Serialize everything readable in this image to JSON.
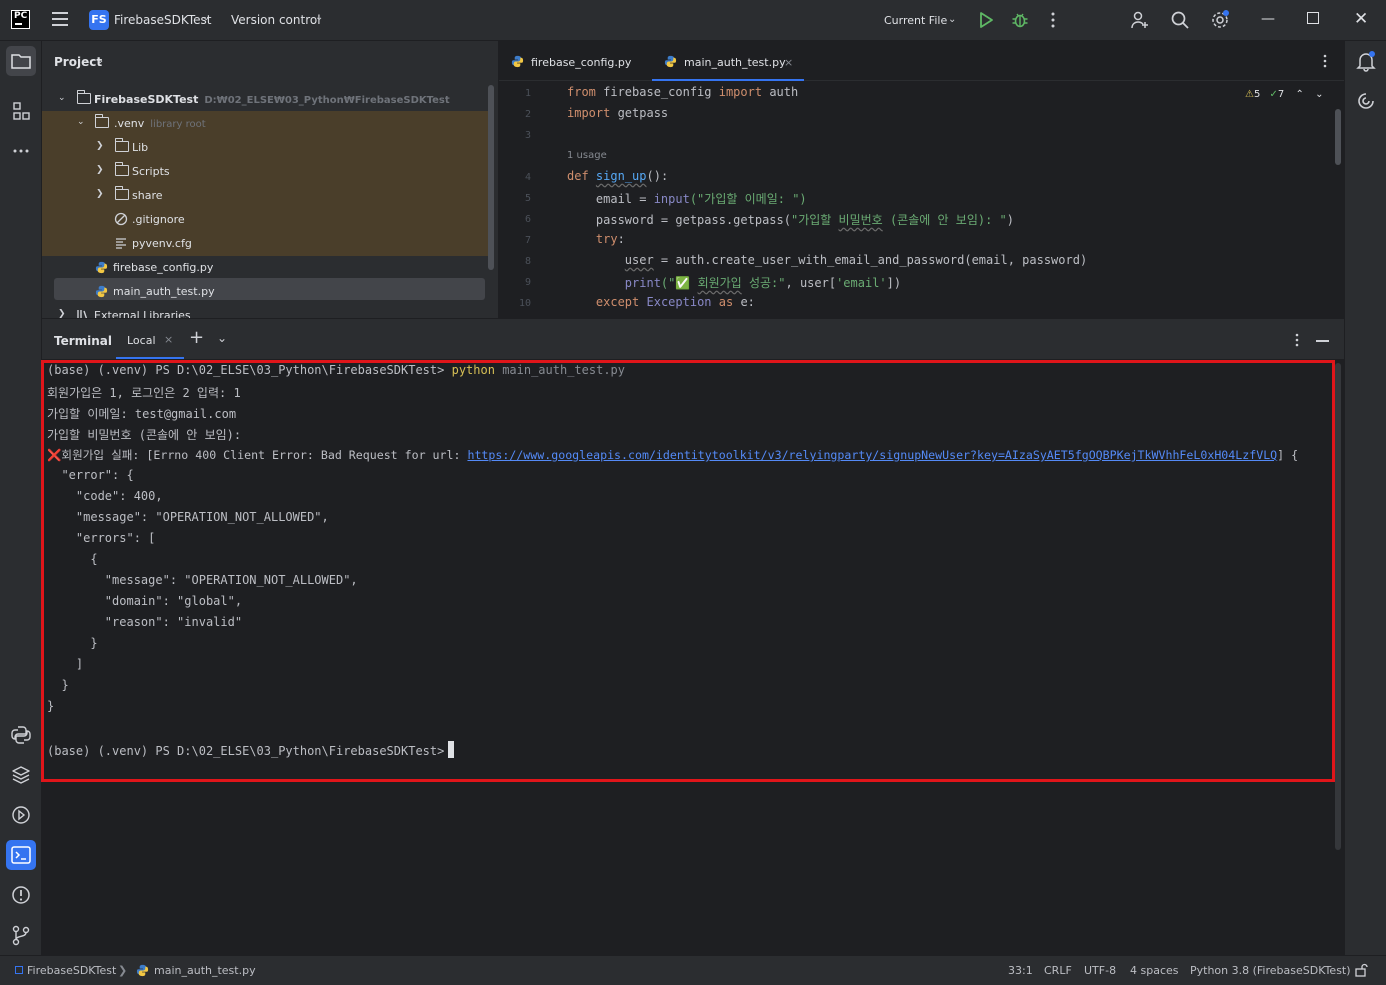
{
  "titlebar": {
    "app_logo": "PC",
    "project_badge": "FS",
    "project_name": "FirebaseSDKTest",
    "version_control": "Version control",
    "run_config": "Current File",
    "icons": [
      "hamburger-icon",
      "run-icon",
      "debug-icon",
      "more-icon",
      "add-user-icon",
      "search-icon",
      "settings-icon",
      "minimize-icon",
      "maximize-icon",
      "close-icon"
    ]
  },
  "project_panel": {
    "title": "Project",
    "tree": [
      {
        "label": "FirebaseSDKTest",
        "hint": "D:₩02_ELSE₩03_Python₩FirebaseSDKTest",
        "type": "folder",
        "expanded": true
      },
      {
        "label": ".venv",
        "hint": "library root",
        "type": "folder",
        "expanded": true
      },
      {
        "label": "Lib",
        "type": "folder"
      },
      {
        "label": "Scripts",
        "type": "folder"
      },
      {
        "label": "share",
        "type": "folder"
      },
      {
        "label": ".gitignore",
        "type": "ignore-file"
      },
      {
        "label": "pyvenv.cfg",
        "type": "config-file"
      },
      {
        "label": "firebase_config.py",
        "type": "python-file"
      },
      {
        "label": "main_auth_test.py",
        "type": "python-file",
        "selected": true
      },
      {
        "label": "External Libraries",
        "type": "library"
      }
    ]
  },
  "editor": {
    "tabs": [
      {
        "label": "firebase_config.py",
        "active": false
      },
      {
        "label": "main_auth_test.py",
        "active": true,
        "close": "×"
      }
    ],
    "inspections": {
      "warnings": "5",
      "ok": "7"
    },
    "usage_hint": "1 usage",
    "line_numbers": [
      "1",
      "2",
      "3",
      "4",
      "5",
      "6",
      "7",
      "8",
      "9",
      "10"
    ],
    "code": {
      "l1": [
        "from",
        " firebase_config ",
        "import",
        " auth"
      ],
      "l2": [
        "import",
        " getpass"
      ],
      "l4": [
        "def",
        " ",
        "sign_up",
        "():"
      ],
      "l5": [
        "    email = ",
        "input",
        "(\"가입할 이메일: \")"
      ],
      "l6": [
        "    password = getpass.getpass(",
        "\"가입할 ",
        "비밀번호",
        " (콘솔에 안 보임): \"",
        ")"
      ],
      "l7": [
        "    ",
        "try",
        ":"
      ],
      "l8": [
        "        ",
        "user",
        " = auth.create_user_with_email_and_password(email, password)"
      ],
      "l9": [
        "        ",
        "print",
        "(\"",
        "✅",
        " ",
        "회원가입",
        " 성공:\"",
        ", user[",
        "'email'",
        "])"
      ],
      "l10": [
        "    ",
        "except",
        " ",
        "Exception",
        " ",
        "as",
        " e:"
      ]
    }
  },
  "terminal": {
    "title": "Terminal",
    "tab": "Local",
    "tab_close": "×",
    "prompt": "(base) (.venv) PS D:\\02_ELSE\\03_Python\\FirebaseSDKTest>",
    "command": "python",
    "command_arg": "main_auth_test.py",
    "lines": [
      "회원가입은 1, 로그인은 2 입력: 1",
      "가입할 이메일: test@gmail.com",
      "가입할 비밀번호 (콘솔에 안 보임):"
    ],
    "error_prefix": "❌회원가입 실패: [Errno 400 Client Error: Bad Request for url: ",
    "error_url": "https://www.googleapis.com/identitytoolkit/v3/relyingparty/signupNewUser?key=AIzaSyAET5fgOQBPKejTkWVhhFeL0xH04LzfVLQ",
    "error_suffix": "] {",
    "json_lines": [
      "  \"error\": {",
      "    \"code\": 400,",
      "    \"message\": \"OPERATION_NOT_ALLOWED\",",
      "    \"errors\": [",
      "      {",
      "        \"message\": \"OPERATION_NOT_ALLOWED\",",
      "        \"domain\": \"global\",",
      "        \"reason\": \"invalid\"",
      "      }",
      "    ]",
      "  }",
      "}"
    ]
  },
  "statusbar": {
    "project": "FirebaseSDKTest",
    "file": "main_auth_test.py",
    "position": "33:1",
    "line_sep": "CRLF",
    "encoding": "UTF-8",
    "indent": "4 spaces",
    "interpreter": "Python 3.8 (FirebaseSDKTest)"
  },
  "colors": {
    "accent": "#3574f0",
    "highlight_box": "#e0151a",
    "venv_bg": "#4a3e2a"
  }
}
